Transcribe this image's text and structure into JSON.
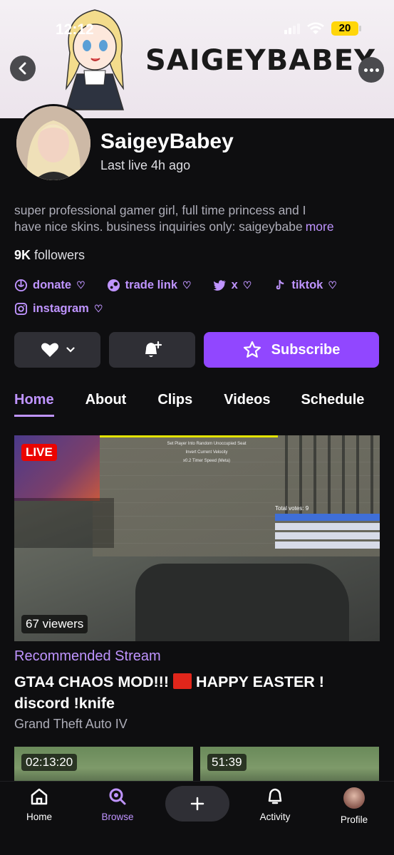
{
  "status_bar": {
    "time": "12:12",
    "battery": "20"
  },
  "banner": {
    "title": "SAIGEYBABEY"
  },
  "profile": {
    "name": "SaigeyBabey",
    "last_live": "Last live 4h ago",
    "bio_line1": "super professional gamer girl, full time princess and I",
    "bio_line2": "have nice skins. business inquiries only: saigeybabe",
    "bio_more": "more",
    "followers_count": "9K",
    "followers_label": "followers"
  },
  "links": [
    {
      "label": "donate",
      "icon": "donate-icon"
    },
    {
      "label": "trade link",
      "icon": "steam-icon"
    },
    {
      "label": "x",
      "icon": "twitter-icon"
    },
    {
      "label": "tiktok",
      "icon": "tiktok-icon"
    },
    {
      "label": "instagram",
      "icon": "instagram-icon"
    }
  ],
  "actions": {
    "subscribe_label": "Subscribe"
  },
  "tabs": [
    {
      "label": "Home",
      "active": true
    },
    {
      "label": "About"
    },
    {
      "label": "Clips"
    },
    {
      "label": "Videos"
    },
    {
      "label": "Schedule"
    }
  ],
  "stream": {
    "live_badge": "LIVE",
    "viewers": "67 viewers",
    "recommended_label": "Recommended Stream",
    "title_part1": "GTA4 CHAOS MOD!!!",
    "title_part2": "HAPPY EASTER ! discord !knife",
    "game": "Grand Theft Auto IV",
    "hud_lines": [
      "Set Player Into Random Unoccupied Seat",
      "Invert Current Velocity",
      "x0.2 Timer Speed (Meta)"
    ],
    "votes_label": "Total votes: 9"
  },
  "vods": [
    {
      "duration": "02:13:20"
    },
    {
      "duration": "51:39"
    }
  ],
  "bottom_nav": {
    "home": "Home",
    "browse": "Browse",
    "activity": "Activity",
    "profile": "Profile"
  },
  "colors": {
    "accent": "#bf94ff",
    "subscribe": "#9147ff",
    "live": "#eb0400",
    "background": "#0e0e10"
  }
}
